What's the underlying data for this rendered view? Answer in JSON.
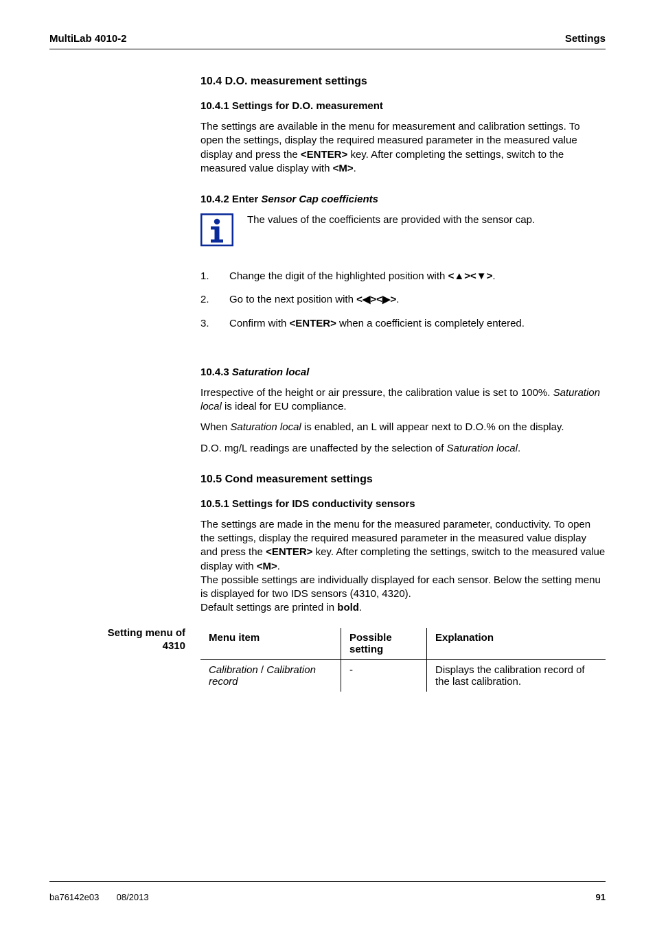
{
  "runhead": {
    "left": "MultiLab 4010-2",
    "right": "Settings"
  },
  "sec10_4": {
    "title": "10.4   D.O. measurement settings",
    "s10_4_1": {
      "title": "10.4.1  Settings for D.O. measurement",
      "para": {
        "pre": "The settings are available in the menu for measurement and calibration settings. To open the settings, display the required measured parameter in the measured value display and press the ",
        "k1": "<ENTER>",
        "mid": " key. After completing the settings, switch to the measured value display with ",
        "k2": "<M>",
        "post": "."
      }
    },
    "s10_4_2": {
      "title": "10.4.2  Enter ",
      "title_ital": "Sensor Cap coefficients",
      "note": "The values of the coefficients are provided with the sensor cap.",
      "steps": [
        {
          "n": "1.",
          "pre": "Change the digit of the highlighted position with ",
          "key_open": "<",
          "a1": "▲",
          "key_mid": "><",
          "a2": "▼",
          "key_close": ">",
          "post": "."
        },
        {
          "n": "2.",
          "pre": "Go to the next position with ",
          "key_open": "<",
          "a1": "◀",
          "key_mid": "><",
          "a2": "▶",
          "key_close": ">",
          "post": "."
        },
        {
          "n": "3.",
          "pre": "Confirm with ",
          "k": "<ENTER>",
          "post": " when a coefficient is completely entered."
        }
      ]
    },
    "s10_4_3": {
      "title": "10.4.3  ",
      "title_ital": "Saturation local",
      "p1_pre": "Irrespective of the height or air pressure, the calibration value is set to 100%. ",
      "p1_ital": "Saturation local",
      "p1_post": " is ideal for EU compliance.",
      "p2_pre": "When ",
      "p2_ital": "Saturation local",
      "p2_post": " is enabled, an L will appear next to D.O.% on the display.",
      "p3_pre": "D.O. mg/L readings are unaffected by the selection of ",
      "p3_ital": "Saturation local",
      "p3_post": "."
    }
  },
  "sec10_5": {
    "title": "10.5   Cond measurement settings",
    "s10_5_1": {
      "title": "10.5.1  Settings for IDS conductivity sensors",
      "para": {
        "p1a": "The settings are made in the menu for the measured parameter, conductivity. To open the settings, display the required measured parameter in the measured value display and press the ",
        "k1": "<ENTER>",
        "p1b": " key. After completing the settings, switch to the measured value display with ",
        "k2": "<M>",
        "p1c": ".",
        "p2": "The possible settings are individually displayed for each sensor. Below the setting menu is displayed for two IDS sensors (4310, 4320).",
        "p3a": "Default settings are printed in ",
        "p3b": "bold",
        "p3c": "."
      }
    }
  },
  "sideLabel": {
    "line1": "Setting menu of",
    "line2": "4310"
  },
  "table": {
    "head": {
      "c1": "Menu item",
      "c2": "Possible setting",
      "c3": "Explanation"
    },
    "rows": [
      {
        "item1": "Calibration",
        "item_sep": " / ",
        "item2": "Calibration record",
        "poss": "-",
        "exp": "Displays the calibration record of the last calibration."
      }
    ]
  },
  "runfoot": {
    "left1": "ba76142e03",
    "left2": "08/2013",
    "right": "91"
  },
  "icon": {
    "name": "info-icon"
  }
}
